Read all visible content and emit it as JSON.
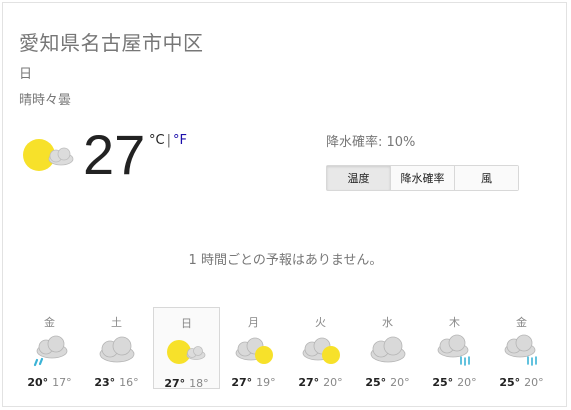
{
  "location": "愛知県名古屋市中区",
  "day": "日",
  "condition": "晴時々曇",
  "current": {
    "temp": "27",
    "unit_c": "°C",
    "sep": "|",
    "unit_f": "°F",
    "icon": "sun-cloud-icon"
  },
  "precip": "降水確率: 10%",
  "tabs": [
    "温度",
    "降水確率",
    "風"
  ],
  "hourly_msg": "1 時間ごとの予報はありません。",
  "forecast": [
    {
      "label": "金",
      "icon": "rain-cloud-icon",
      "hi": "20°",
      "lo": "17°"
    },
    {
      "label": "土",
      "icon": "cloud-icon",
      "hi": "23°",
      "lo": "16°"
    },
    {
      "label": "日",
      "icon": "sun-cloud-icon",
      "hi": "27°",
      "lo": "18°"
    },
    {
      "label": "月",
      "icon": "cloud-sun-icon",
      "hi": "27°",
      "lo": "19°"
    },
    {
      "label": "火",
      "icon": "cloud-sun-icon",
      "hi": "27°",
      "lo": "20°"
    },
    {
      "label": "水",
      "icon": "cloud-icon",
      "hi": "25°",
      "lo": "20°"
    },
    {
      "label": "木",
      "icon": "rain-cloud-icon",
      "hi": "25°",
      "lo": "20°"
    },
    {
      "label": "金",
      "icon": "rain-cloud-icon",
      "hi": "25°",
      "lo": "20°"
    }
  ],
  "colors": {
    "sun": "#f7e12a",
    "cloud": "#d4d4d4",
    "rain": "#3bb3d6",
    "link": "#1a0dab"
  }
}
